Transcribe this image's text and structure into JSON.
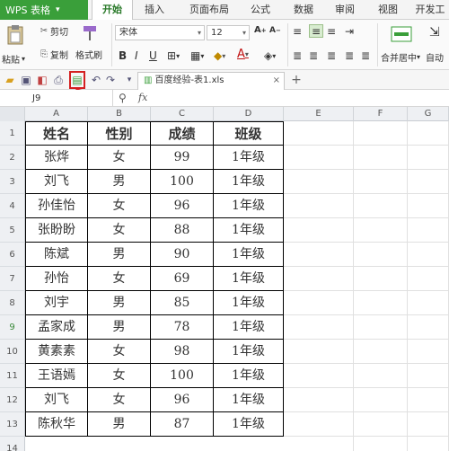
{
  "app": {
    "name": "WPS 表格",
    "menu_tabs": [
      "开始",
      "插入",
      "页面布局",
      "公式",
      "数据",
      "审阅",
      "视图",
      "开发工"
    ]
  },
  "ribbon": {
    "paste_label": "粘贴",
    "cut_label": "剪切",
    "copy_label": "复制",
    "format_painter_label": "格式刷",
    "font_name": "宋体",
    "font_size": "12",
    "merge_center_label": "合并居中",
    "auto_label": "自动"
  },
  "document": {
    "tab_title": "百度经验-表1.xls"
  },
  "formula_bar": {
    "cell_ref": "J9",
    "fx_label": "fx"
  },
  "grid": {
    "column_letters": [
      "A",
      "B",
      "C",
      "D",
      "E",
      "F",
      "G"
    ],
    "row_numbers": [
      "1",
      "2",
      "3",
      "4",
      "5",
      "6",
      "7",
      "8",
      "9",
      "10",
      "11",
      "12",
      "13",
      "14"
    ],
    "selected_row": "9",
    "table_header": [
      "姓名",
      "性别",
      "成绩",
      "班级"
    ],
    "rows": [
      [
        "张烨",
        "女",
        "99",
        "1年级"
      ],
      [
        "刘飞",
        "男",
        "100",
        "1年级"
      ],
      [
        "孙佳怡",
        "女",
        "96",
        "1年级"
      ],
      [
        "张盼盼",
        "女",
        "88",
        "1年级"
      ],
      [
        "陈斌",
        "男",
        "90",
        "1年级"
      ],
      [
        "孙怡",
        "女",
        "69",
        "1年级"
      ],
      [
        "刘宇",
        "男",
        "85",
        "1年级"
      ],
      [
        "孟家成",
        "男",
        "78",
        "1年级"
      ],
      [
        "黄素素",
        "女",
        "98",
        "1年级"
      ],
      [
        "王语嫣",
        "女",
        "100",
        "1年级"
      ],
      [
        "刘飞",
        "女",
        "96",
        "1年级"
      ],
      [
        "陈秋华",
        "男",
        "87",
        "1年级"
      ]
    ]
  },
  "colors": {
    "accent_green": "#3a9f3a",
    "highlight_red": "#d42020"
  }
}
